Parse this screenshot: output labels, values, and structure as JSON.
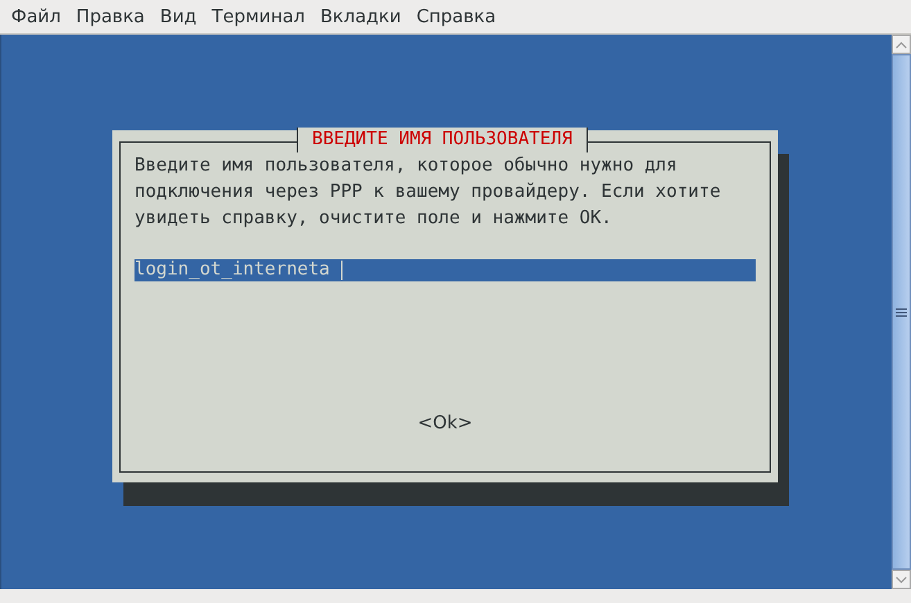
{
  "menu_bar": {
    "items": [
      {
        "label": "Файл"
      },
      {
        "label": "Правка"
      },
      {
        "label": "Вид"
      },
      {
        "label": "Терминал"
      },
      {
        "label": "Вкладки"
      },
      {
        "label": "Справка"
      }
    ]
  },
  "dialog": {
    "title": "ВВЕДИТЕ ИМЯ ПОЛЬЗОВАТЕЛЯ",
    "message": "Введите имя пользователя, которое обычно нужно для\nподключения через PPP к вашему провайдеру. Если хотите\nувидеть справку, очистите поле и нажмите OK.",
    "input": {
      "value": "login_ot_interneta"
    },
    "button": {
      "label": "<Ok>"
    }
  }
}
